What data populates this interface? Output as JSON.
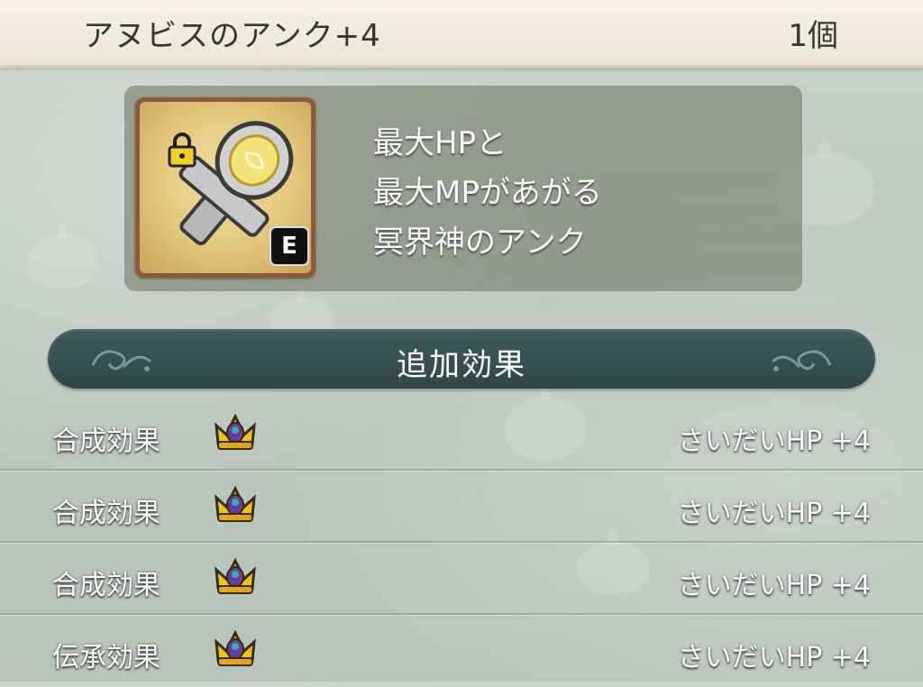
{
  "item": {
    "name": "アヌビスのアンク+4",
    "count": "1個"
  },
  "equip_badge": "E",
  "description": [
    "最大HPと",
    "最大MPがあがる",
    "冥界神のアンク"
  ],
  "section": {
    "title": "追加効果"
  },
  "effects": [
    {
      "type": "合成効果",
      "value": "さいだいHP +4"
    },
    {
      "type": "合成効果",
      "value": "さいだいHP +4"
    },
    {
      "type": "合成効果",
      "value": "さいだいHP +4"
    },
    {
      "type": "伝承効果",
      "value": "さいだいHP +4"
    }
  ],
  "icons": {
    "lock": "lock-icon",
    "item": "ankh-icon",
    "rank": "crown-icon"
  },
  "colors": {
    "title_bar": "#f3eee1",
    "section_header": "#34494d",
    "icon_frame": "#8a5a3a"
  }
}
